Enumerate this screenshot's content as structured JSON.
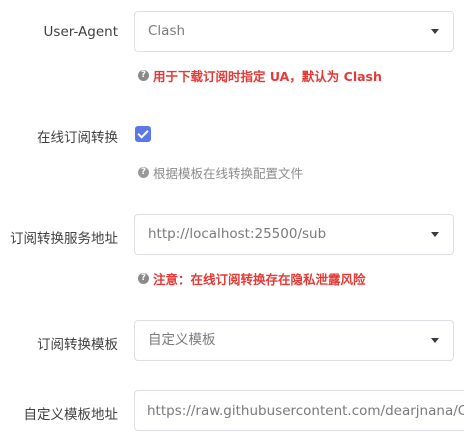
{
  "fields": {
    "user_agent": {
      "label": "User-Agent",
      "value": "Clash",
      "hint": "用于下载订阅时指定 UA，默认为 Clash"
    },
    "online_convert": {
      "label": "在线订阅转换",
      "checked": true,
      "hint": "根据模板在线转换配置文件"
    },
    "convert_service": {
      "label": "订阅转换服务地址",
      "value": "http://localhost:25500/sub",
      "hint": "注意：在线订阅转换存在隐私泄露风险"
    },
    "convert_template": {
      "label": "订阅转换模板",
      "value": "自定义模板"
    },
    "template_url": {
      "label": "自定义模板地址",
      "value": "https://raw.githubusercontent.com/dearjnana/Clash"
    }
  },
  "icons": {
    "hint": "question-circle-icon",
    "dropdown": "caret-down-icon"
  },
  "colors": {
    "accent": "#5b78e8",
    "warning_text": "#e53935",
    "hint_text": "#8c8c8c"
  }
}
